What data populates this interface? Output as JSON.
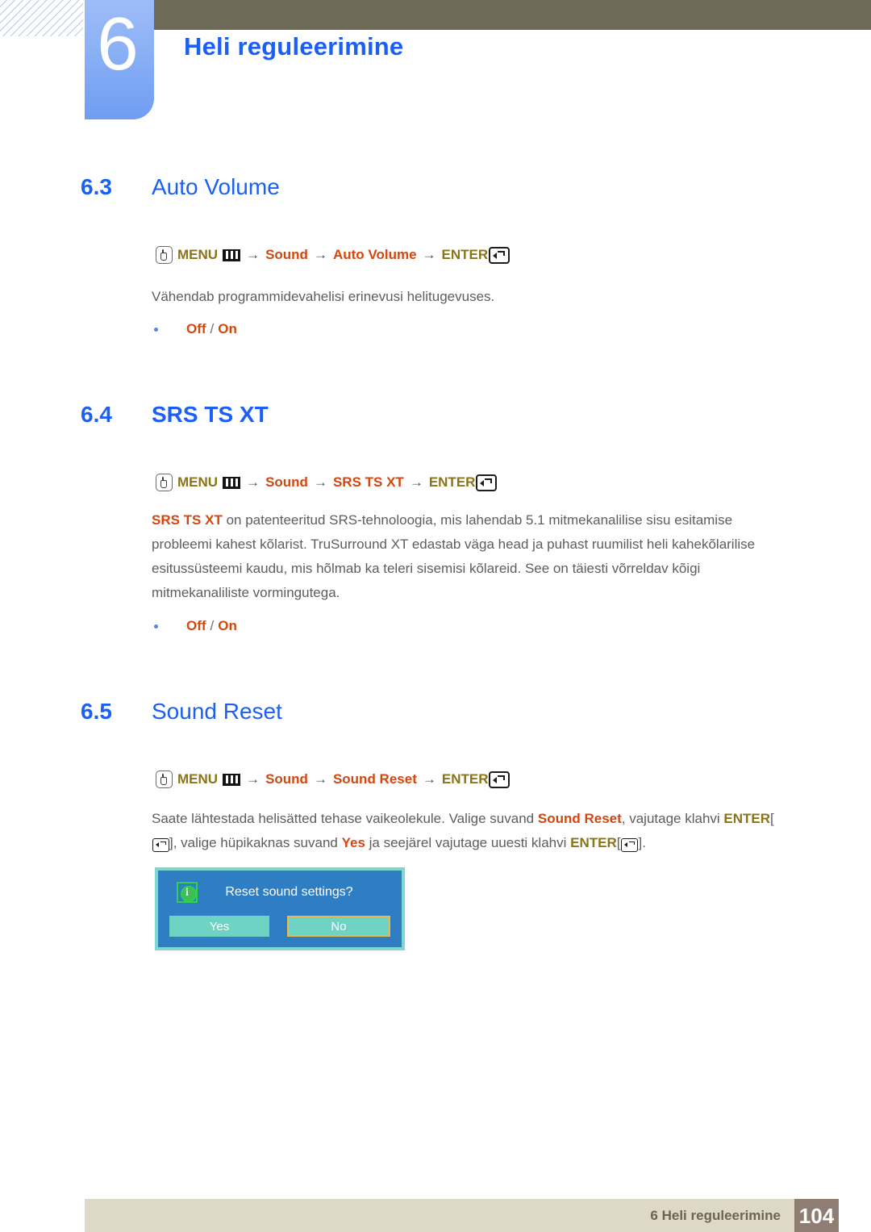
{
  "header": {
    "chapter_number": "6",
    "chapter_title": "Heli reguleerimine",
    "bar_color": "#6d6a57",
    "tab_color": "#8db2f5",
    "title_color": "#1b5ff5"
  },
  "sections": [
    {
      "number": "6.3",
      "title": "Auto Volume",
      "bold_title": false,
      "menupath": {
        "press_icon": "hand-press-icon",
        "menu_label": "MENU",
        "menu_icon": "menu-bars-icon",
        "arrow": "→",
        "step1": "Sound",
        "step2": "Auto Volume",
        "enter_label": "ENTER",
        "enter_icon": "enter-key-icon"
      },
      "paragraph": "Vähendab programmidevahelisi erinevusi helitugevuses.",
      "bullets": [
        {
          "option_a": "Off",
          "separator": "/",
          "option_b": "On"
        }
      ]
    },
    {
      "number": "6.4",
      "title": "SRS TS XT",
      "bold_title": true,
      "menupath": {
        "press_icon": "hand-press-icon",
        "menu_label": "MENU",
        "menu_icon": "menu-bars-icon",
        "arrow": "→",
        "step1": "Sound",
        "step2": "SRS TS XT",
        "enter_label": "ENTER",
        "enter_icon": "enter-key-icon"
      },
      "paragraph_lead": "SRS TS XT",
      "paragraph_rest": " on patenteeritud SRS-tehnoloogia, mis lahendab 5.1 mitmekanalilise sisu esitamise probleemi kahest kõlarist. TruSurround XT edastab väga head ja puhast ruumilist heli kahekõlarilise esitussüsteemi kaudu, mis hõlmab ka teleri sisemisi kõlareid. See on täiesti võrreldav kõigi mitmekanaliliste vormingutega.",
      "bullets": [
        {
          "option_a": "Off",
          "separator": "/",
          "option_b": "On"
        }
      ]
    },
    {
      "number": "6.5",
      "title": "Sound Reset",
      "bold_title": false,
      "menupath": {
        "press_icon": "hand-press-icon",
        "menu_label": "MENU",
        "menu_icon": "menu-bars-icon",
        "arrow": "→",
        "step1": "Sound",
        "step2": "Sound Reset",
        "enter_label": "ENTER",
        "enter_icon": "enter-key-icon"
      },
      "paragraph_parts": {
        "t1": "Saate lähtestada helisätted tehase vaikeolekule. Valige suvand ",
        "hl1": "Sound Reset",
        "t2": ", vajutage klahvi ",
        "hl2": "ENTER",
        "t3": "[",
        "t4": "], valige hüpikaknas suvand ",
        "hl3": "Yes",
        "t5": " ja seejärel vajutage uuesti klahvi ",
        "hl4": "ENTER",
        "t6": "[",
        "t7": "]."
      }
    }
  ],
  "osd_dialog": {
    "info_icon": "info-icon",
    "message": "Reset sound settings?",
    "buttons": [
      {
        "label": "Yes",
        "selected": false
      },
      {
        "label": "No",
        "selected": true
      }
    ],
    "background_color": "#2f7dc2",
    "border_color": "#7fd8d0",
    "button_color": "#6fd3c4",
    "highlight_color": "#e8b84b"
  },
  "footer": {
    "label": "6 Heli reguleerimine",
    "page_number": "104",
    "bar_color": "#ded8c6",
    "page_box_color": "#8d7d72"
  }
}
